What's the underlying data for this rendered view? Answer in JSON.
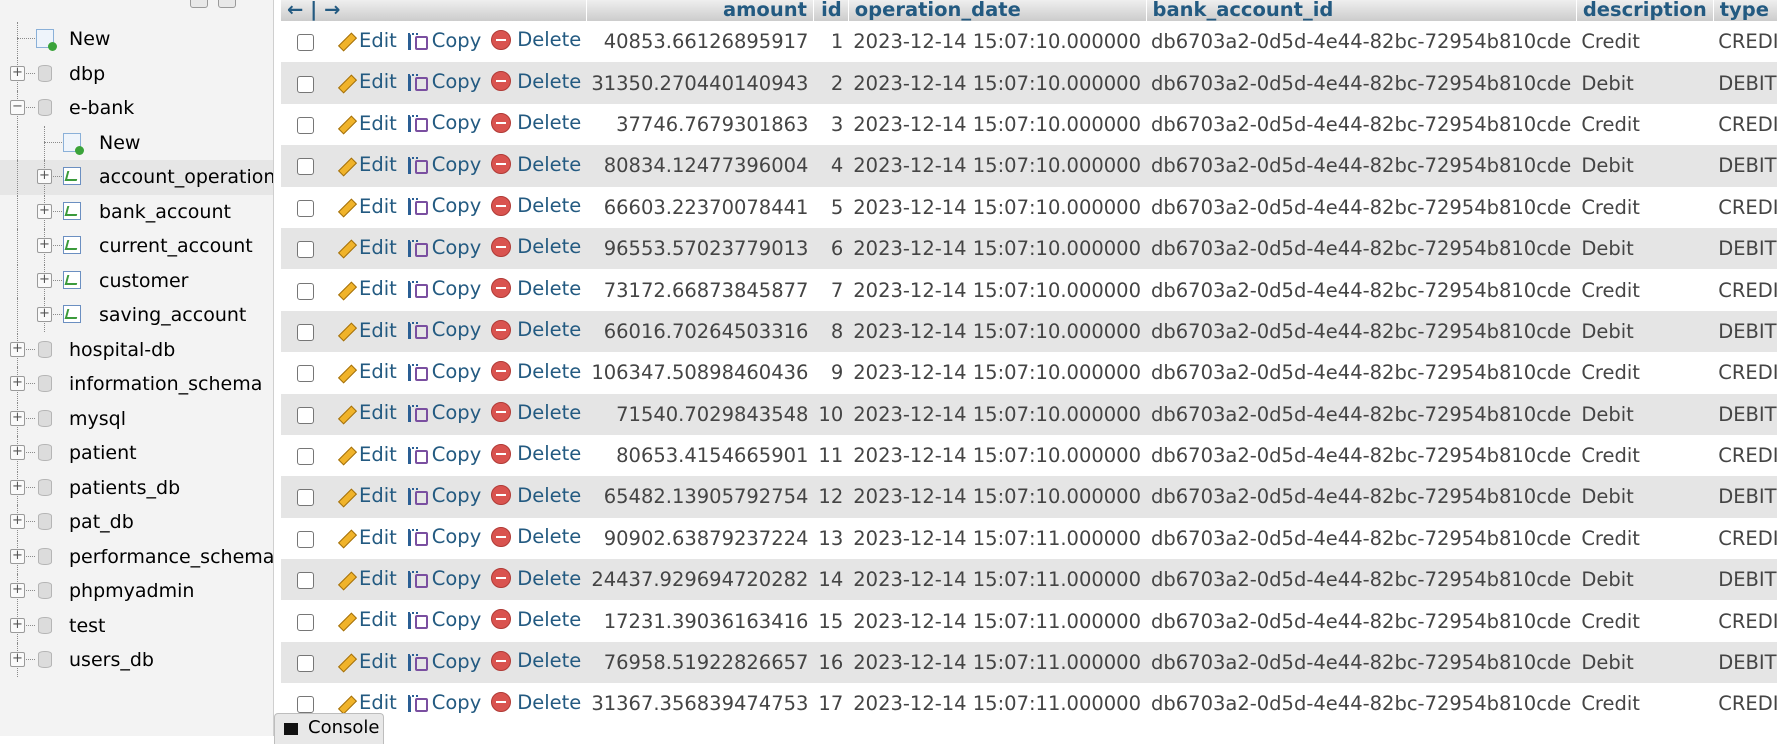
{
  "navigation": {
    "tree": [
      {
        "label": "New",
        "kind": "new",
        "level": 0
      },
      {
        "label": "dbp",
        "kind": "db",
        "level": 0,
        "expander": "+"
      },
      {
        "label": "e-bank",
        "kind": "db",
        "level": 0,
        "expander": "−"
      },
      {
        "label": "New",
        "kind": "new",
        "level": 1
      },
      {
        "label": "account_operation",
        "kind": "table",
        "level": 1,
        "expander": "+",
        "active": true
      },
      {
        "label": "bank_account",
        "kind": "table",
        "level": 1,
        "expander": "+"
      },
      {
        "label": "current_account",
        "kind": "table",
        "level": 1,
        "expander": "+"
      },
      {
        "label": "customer",
        "kind": "table",
        "level": 1,
        "expander": "+"
      },
      {
        "label": "saving_account",
        "kind": "table",
        "level": 1,
        "expander": "+"
      },
      {
        "label": "hospital-db",
        "kind": "db",
        "level": 0,
        "expander": "+"
      },
      {
        "label": "information_schema",
        "kind": "db",
        "level": 0,
        "expander": "+"
      },
      {
        "label": "mysql",
        "kind": "db",
        "level": 0,
        "expander": "+"
      },
      {
        "label": "patient",
        "kind": "db",
        "level": 0,
        "expander": "+"
      },
      {
        "label": "patients_db",
        "kind": "db",
        "level": 0,
        "expander": "+"
      },
      {
        "label": "pat_db",
        "kind": "db",
        "level": 0,
        "expander": "+"
      },
      {
        "label": "performance_schema",
        "kind": "db",
        "level": 0,
        "expander": "+"
      },
      {
        "label": "phpmyadmin",
        "kind": "db",
        "level": 0,
        "expander": "+"
      },
      {
        "label": "test",
        "kind": "db",
        "level": 0,
        "expander": "+"
      },
      {
        "label": "users_db",
        "kind": "db",
        "level": 0,
        "expander": "+"
      }
    ]
  },
  "grid": {
    "arrows": "← | →",
    "columns": [
      "amount",
      "id",
      "operation_date",
      "bank_account_id",
      "description",
      "type"
    ],
    "actions": {
      "edit": "Edit",
      "copy": "Copy",
      "delete": "Delete"
    },
    "rows": [
      {
        "amount": "40853.66126895917",
        "id": "1",
        "operation_date": "2023-12-14 15:07:10.000000",
        "bank_account_id": "db6703a2-0d5d-4e44-82bc-72954b810cde",
        "description": "Credit",
        "type": "CREDIT"
      },
      {
        "amount": "31350.270440140943",
        "id": "2",
        "operation_date": "2023-12-14 15:07:10.000000",
        "bank_account_id": "db6703a2-0d5d-4e44-82bc-72954b810cde",
        "description": "Debit",
        "type": "DEBIT"
      },
      {
        "amount": "37746.7679301863",
        "id": "3",
        "operation_date": "2023-12-14 15:07:10.000000",
        "bank_account_id": "db6703a2-0d5d-4e44-82bc-72954b810cde",
        "description": "Credit",
        "type": "CREDIT"
      },
      {
        "amount": "80834.12477396004",
        "id": "4",
        "operation_date": "2023-12-14 15:07:10.000000",
        "bank_account_id": "db6703a2-0d5d-4e44-82bc-72954b810cde",
        "description": "Debit",
        "type": "DEBIT"
      },
      {
        "amount": "66603.22370078441",
        "id": "5",
        "operation_date": "2023-12-14 15:07:10.000000",
        "bank_account_id": "db6703a2-0d5d-4e44-82bc-72954b810cde",
        "description": "Credit",
        "type": "CREDIT"
      },
      {
        "amount": "96553.57023779013",
        "id": "6",
        "operation_date": "2023-12-14 15:07:10.000000",
        "bank_account_id": "db6703a2-0d5d-4e44-82bc-72954b810cde",
        "description": "Debit",
        "type": "DEBIT"
      },
      {
        "amount": "73172.66873845877",
        "id": "7",
        "operation_date": "2023-12-14 15:07:10.000000",
        "bank_account_id": "db6703a2-0d5d-4e44-82bc-72954b810cde",
        "description": "Credit",
        "type": "CREDIT"
      },
      {
        "amount": "66016.70264503316",
        "id": "8",
        "operation_date": "2023-12-14 15:07:10.000000",
        "bank_account_id": "db6703a2-0d5d-4e44-82bc-72954b810cde",
        "description": "Debit",
        "type": "DEBIT"
      },
      {
        "amount": "106347.50898460436",
        "id": "9",
        "operation_date": "2023-12-14 15:07:10.000000",
        "bank_account_id": "db6703a2-0d5d-4e44-82bc-72954b810cde",
        "description": "Credit",
        "type": "CREDIT"
      },
      {
        "amount": "71540.7029843548",
        "id": "10",
        "operation_date": "2023-12-14 15:07:10.000000",
        "bank_account_id": "db6703a2-0d5d-4e44-82bc-72954b810cde",
        "description": "Debit",
        "type": "DEBIT"
      },
      {
        "amount": "80653.4154665901",
        "id": "11",
        "operation_date": "2023-12-14 15:07:10.000000",
        "bank_account_id": "db6703a2-0d5d-4e44-82bc-72954b810cde",
        "description": "Credit",
        "type": "CREDIT"
      },
      {
        "amount": "65482.13905792754",
        "id": "12",
        "operation_date": "2023-12-14 15:07:10.000000",
        "bank_account_id": "db6703a2-0d5d-4e44-82bc-72954b810cde",
        "description": "Debit",
        "type": "DEBIT"
      },
      {
        "amount": "90902.63879237224",
        "id": "13",
        "operation_date": "2023-12-14 15:07:11.000000",
        "bank_account_id": "db6703a2-0d5d-4e44-82bc-72954b810cde",
        "description": "Credit",
        "type": "CREDIT"
      },
      {
        "amount": "24437.929694720282",
        "id": "14",
        "operation_date": "2023-12-14 15:07:11.000000",
        "bank_account_id": "db6703a2-0d5d-4e44-82bc-72954b810cde",
        "description": "Debit",
        "type": "DEBIT"
      },
      {
        "amount": "17231.39036163416",
        "id": "15",
        "operation_date": "2023-12-14 15:07:11.000000",
        "bank_account_id": "db6703a2-0d5d-4e44-82bc-72954b810cde",
        "description": "Credit",
        "type": "CREDIT"
      },
      {
        "amount": "76958.51922826657",
        "id": "16",
        "operation_date": "2023-12-14 15:07:11.000000",
        "bank_account_id": "db6703a2-0d5d-4e44-82bc-72954b810cde",
        "description": "Debit",
        "type": "DEBIT"
      },
      {
        "amount": "31367.356839474753",
        "id": "17",
        "operation_date": "2023-12-14 15:07:11.000000",
        "bank_account_id": "db6703a2-0d5d-4e44-82bc-72954b810cde",
        "description": "Credit",
        "type": "CREDIT"
      }
    ]
  },
  "console": {
    "label": "Console"
  },
  "colors": {
    "link": "#235a81",
    "row_alt": "#e5e5e5",
    "nav_bg": "#f3f3f3"
  }
}
